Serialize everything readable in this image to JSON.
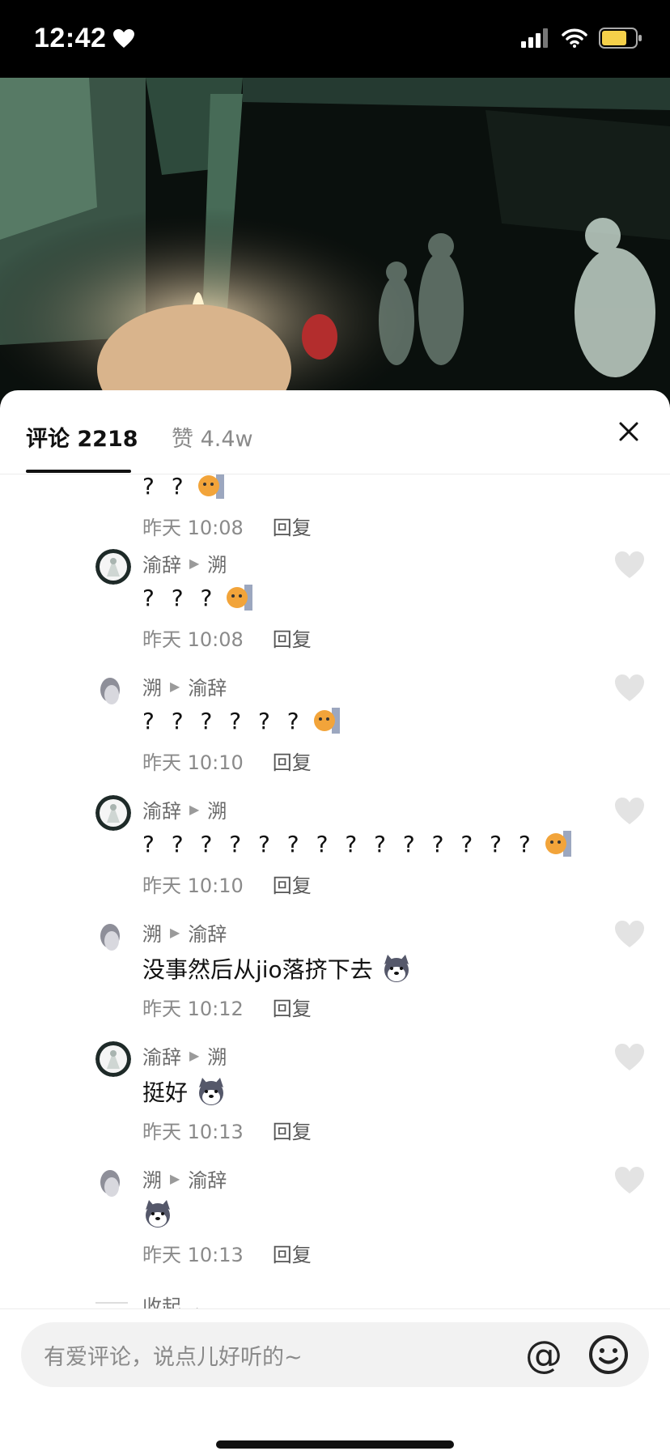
{
  "status_bar": {
    "time": "12:42"
  },
  "tabs": {
    "comments_label": "评论 2218",
    "likes_label": "赞 4.4w"
  },
  "partial_top": {
    "text": "? ?",
    "time": "昨天 10:08",
    "reply": "回复"
  },
  "replies": [
    {
      "from": "渝辞",
      "to": "溯",
      "text": "? ? ?",
      "emoji": "cat",
      "time": "昨天 10:08",
      "reply": "回复"
    },
    {
      "from": "溯",
      "to": "渝辞",
      "text": "? ? ? ? ? ?",
      "emoji": "cat",
      "time": "昨天 10:10",
      "reply": "回复"
    },
    {
      "from": "渝辞",
      "to": "溯",
      "text": "? ? ? ? ? ? ? ? ? ? ? ? ? ?",
      "emoji": "cat",
      "time": "昨天 10:10",
      "reply": "回复"
    },
    {
      "from": "溯",
      "to": "渝辞",
      "text": "没事然后从jio落挤下去",
      "emoji": "husky",
      "time": "昨天 10:12",
      "reply": "回复"
    },
    {
      "from": "渝辞",
      "to": "溯",
      "text": "挺好",
      "emoji": "husky",
      "time": "昨天 10:13",
      "reply": "回复"
    },
    {
      "from": "溯",
      "to": "渝辞",
      "text": "",
      "emoji": "husky",
      "time": "昨天 10:13",
      "reply": "回复"
    }
  ],
  "collapse_label": "收起",
  "input": {
    "placeholder": "有爱评论，说点儿好听的~",
    "at_symbol": "@"
  },
  "colors": {
    "background": "#ffffff",
    "primary_text": "#111111",
    "secondary_text": "#8a8a8a",
    "heart": "#e3e3e3"
  }
}
